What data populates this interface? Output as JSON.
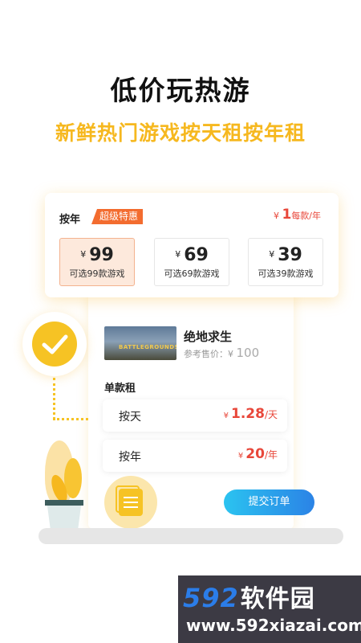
{
  "headline": "低价玩热游",
  "subline": "新鲜热门游戏按天租按年租",
  "year_card": {
    "label": "按年",
    "badge": "超级特惠",
    "per_price": {
      "currency": "¥",
      "amount": "1",
      "unit": "每款/年"
    },
    "plans": [
      {
        "currency": "¥",
        "amount": "99",
        "desc": "可选99款游戏",
        "selected": true
      },
      {
        "currency": "¥",
        "amount": "69",
        "desc": "可选69款游戏",
        "selected": false
      },
      {
        "currency": "¥",
        "amount": "39",
        "desc": "可选39款游戏",
        "selected": false
      }
    ]
  },
  "game": {
    "thumb_text": "BATTLEGROUNDS",
    "title": "绝地求生",
    "ref_label": "参考售价：",
    "ref_currency": "¥",
    "ref_amount": "100"
  },
  "single": {
    "label": "单款租",
    "rows": [
      {
        "label": "按天",
        "currency": "¥",
        "amount": "1.28",
        "unit": "/天"
      },
      {
        "label": "按年",
        "currency": "¥",
        "amount": "20",
        "unit": "/年"
      }
    ]
  },
  "submit_label": "提交订单",
  "watermark": {
    "digits": "592",
    "brand": "软件园",
    "url": "www.592xiazai.com"
  },
  "colors": {
    "accent_yellow": "#f6c324",
    "price_red": "#e8473a",
    "badge_orange": "#f36c2f",
    "button_blue": "#2b9be9"
  },
  "icons": [
    "check-icon",
    "document-icon",
    "plant-illustration"
  ]
}
